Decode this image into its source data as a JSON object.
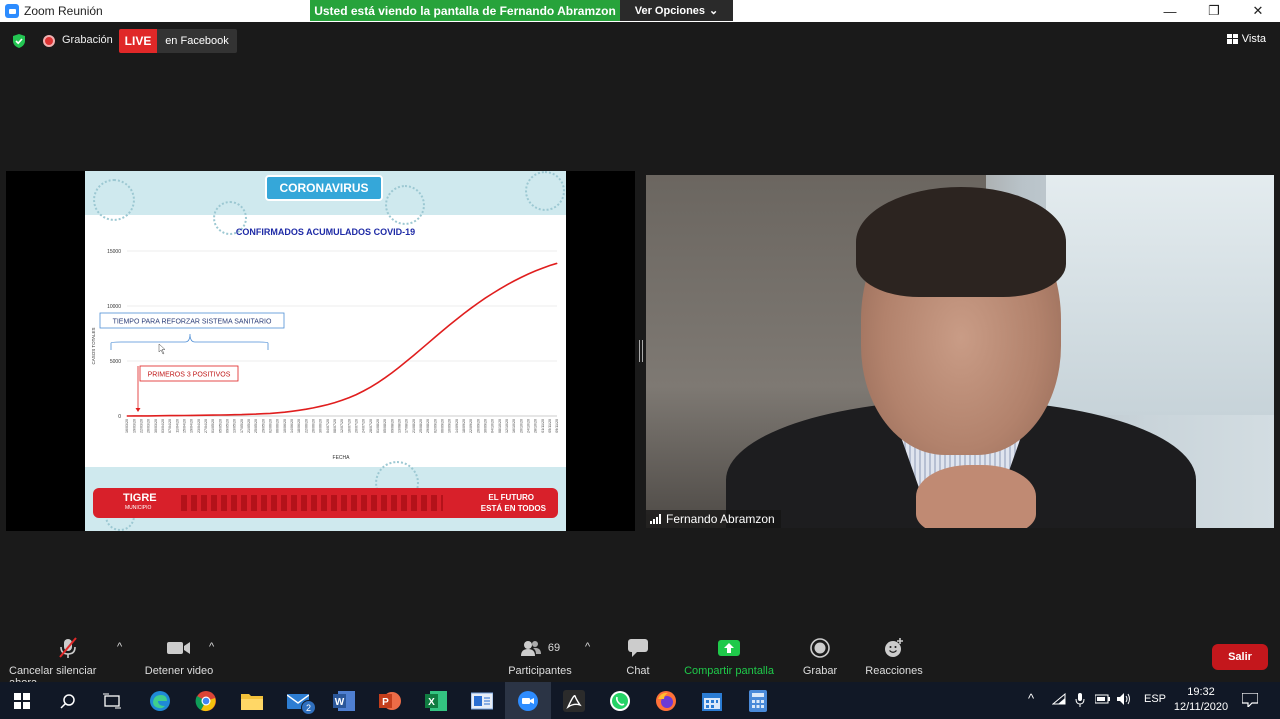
{
  "window": {
    "title": "Zoom Reunión",
    "share_banner": "Usted está viendo la pantalla de Fernando Abramzon",
    "view_options": "Ver Opciones",
    "controls": {
      "minimize": "—",
      "restore": "❐",
      "close": "✕"
    }
  },
  "topbar": {
    "recording_label": "Grabación",
    "live_label": "LIVE",
    "live_platform": "en Facebook",
    "view_label": "Vista"
  },
  "slide": {
    "header_title": "CORONAVIRUS",
    "footer_logo": "TIGRE",
    "footer_logo_sub": "MUNICIPIO",
    "footer_slogan_line1": "EL FUTURO",
    "footer_slogan_line2": "ESTÁ EN TODOS"
  },
  "chart_data": {
    "type": "line",
    "title": "CONFIRMADOS ACUMULADOS COVID-19",
    "xlabel": "FECHA",
    "ylabel": "CASOS TOTALES",
    "ylim": [
      0,
      15000
    ],
    "yticks": [
      0,
      5000,
      10000,
      15000
    ],
    "x": [
      "16/03/20",
      "19/03/20",
      "22/03/20",
      "26/03/20",
      "30/03/20",
      "03/04/20",
      "07/04/20",
      "11/04/20",
      "15/04/20",
      "19/04/20",
      "23/04/20",
      "27/04/20",
      "01/05/20",
      "05/05/20",
      "09/05/20",
      "13/05/20",
      "17/05/20",
      "21/05/20",
      "25/05/20",
      "29/05/20",
      "02/06/20",
      "06/06/20",
      "10/06/20",
      "14/06/20",
      "18/06/20",
      "22/06/20",
      "26/06/20",
      "30/06/20",
      "04/07/20",
      "08/07/20",
      "12/07/20",
      "16/07/20",
      "20/07/20",
      "24/07/20",
      "28/07/20",
      "01/08/20",
      "05/08/20",
      "09/08/20",
      "13/08/20",
      "17/08/20",
      "21/08/20",
      "25/08/20",
      "29/08/20",
      "02/09/20",
      "06/09/20",
      "10/09/20",
      "14/09/20",
      "18/09/20",
      "22/09/20",
      "26/09/20",
      "30/09/20",
      "04/10/20",
      "08/10/20",
      "12/10/20",
      "16/10/20",
      "20/10/20",
      "24/10/20",
      "28/10/20",
      "01/11/20",
      "05/11/20",
      "09/11/20"
    ],
    "series": [
      {
        "values": [
          3,
          5,
          8,
          12,
          18,
          25,
          32,
          40,
          48,
          55,
          62,
          70,
          78,
          88,
          100,
          115,
          130,
          150,
          175,
          205,
          240,
          290,
          350,
          430,
          520,
          620,
          740,
          880,
          1040,
          1220,
          1430,
          1670,
          1950,
          2270,
          2630,
          3030,
          3470,
          3950,
          4450,
          4970,
          5510,
          6060,
          6620,
          7180,
          7730,
          8270,
          8800,
          9310,
          9800,
          10270,
          10720,
          11140,
          11540,
          11920,
          12270,
          12600,
          12910,
          13190,
          13450,
          13680,
          13880
        ]
      }
    ],
    "annotations": [
      {
        "label": "TIEMPO PARA REFORZAR SISTEMA SANITARIO"
      },
      {
        "label": "PRIMEROS 3 POSITIVOS"
      }
    ],
    "line_color": "#e01e1e",
    "grid": true
  },
  "participant": {
    "name": "Fernando Abramzon"
  },
  "toolbar": {
    "mute_label": "Cancelar silenciar ahora",
    "video_label": "Detener video",
    "participants_label": "Participantes",
    "participants_count": "69",
    "chat_label": "Chat",
    "share_label": "Compartir pantalla",
    "record_label": "Grabar",
    "reactions_label": "Reacciones",
    "leave_label": "Salir"
  },
  "taskbar": {
    "mail_badge": "2",
    "language": "ESP",
    "time": "19:32",
    "date": "12/11/2020"
  },
  "colors": {
    "accent_green": "#27a33b",
    "live_red": "#e02828",
    "leave_red": "#c4171c",
    "zoom_blue": "#2d8cff"
  }
}
